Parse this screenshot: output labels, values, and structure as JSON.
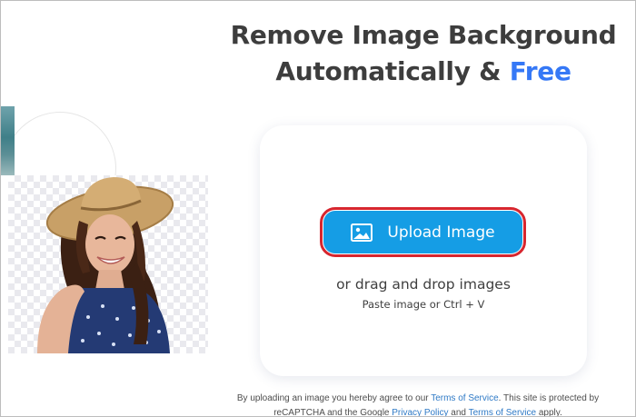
{
  "headline": {
    "line1": "Remove Image Background",
    "line2_prefix": "Automatically &",
    "line2_highlight": "Free"
  },
  "upload": {
    "button_label": "Upload Image",
    "icon": "image-icon",
    "drag_text": "or drag and drop images",
    "paste_text": "Paste image or Ctrl + V"
  },
  "legal": {
    "part1": "By uploading an image you hereby agree to our",
    "terms_link_1": "Terms of Service",
    "part2": ". This site is protected by reCAPTCHA and the Google",
    "privacy_link": "Privacy Policy",
    "part3": "and",
    "terms_link_2": "Terms of Service",
    "part4": "apply."
  },
  "hero": {
    "image": "woman-in-sun-hat-photo"
  },
  "colors": {
    "accent": "#3578f6",
    "button": "#159de5",
    "highlight_ring": "#d7262f",
    "link": "#2f7ac6",
    "heading": "#3d3d3d"
  }
}
